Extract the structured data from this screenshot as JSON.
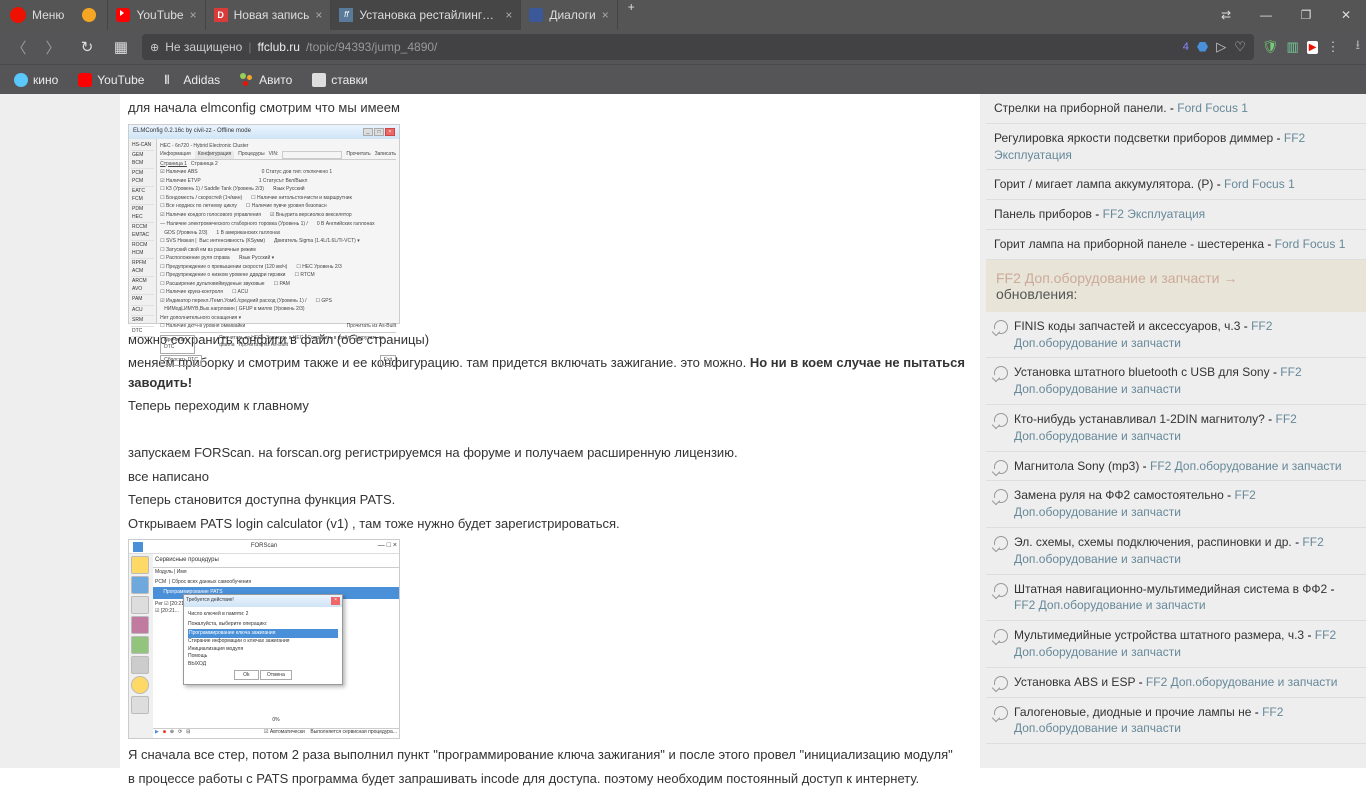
{
  "titlebar": {
    "menu": "Меню",
    "tabs": [
      {
        "title": "",
        "fav_color": "#f5a623"
      },
      {
        "title": "YouTube",
        "fav_color": "#ff0000"
      },
      {
        "title": "Новая запись",
        "fav_color": "#d93a3a",
        "fav_letter": "D"
      },
      {
        "title": "Установка рестайлингово",
        "fav_color": "#5a7a99",
        "fav_letter": "ff",
        "active": true
      },
      {
        "title": "Диалоги",
        "fav_color": "#3b5998"
      }
    ]
  },
  "address": {
    "insecure": "Не защищено",
    "domain": "ffclub.ru",
    "path": "/topic/94393/jump_4890/",
    "badge": "4"
  },
  "bookmarks": [
    {
      "label": "кино",
      "color": "#5ac8fa"
    },
    {
      "label": "YouTube",
      "color": "#ff0000"
    },
    {
      "label": "Adidas",
      "color": "#fff"
    },
    {
      "label": "Авито",
      "color": "#97d058"
    },
    {
      "label": "ставки",
      "color": "#ddd"
    }
  ],
  "post": {
    "p1": "для начала elmconfig смотрим что мы имеем",
    "p2": "можно сохранить конфиги в файл (обе страницы)",
    "p3": "меняем приборку и смотрим также и ее конфигурацию. там придется включать зажигание. это можно. ",
    "p3b": "Но ни в коем случае не пытаться заводить!",
    "p4": "Теперь переходим к главному",
    "p5": "запускаем FORScan. на forscan.org регистрируемся на форуме и получаем расширенную лицензию.",
    "p6": "все написано",
    "p7": "Теперь становится доступна функция PATS.",
    "p8": "Открываем PATS login calculator (v1) , там тоже нужно будет зарегистрироваться.",
    "p9": "Я сначала все стер, потом 2 раза выполнил пункт \"программирование ключа зажигания\" и после этого провел \"инициализацию модуля\"",
    "p10": "в процессе работы с PATS программа будет запрашивать incode для доступа. поэтому необходим постоянный доступ к интернету.",
    "elm_title": "ELMConfig 0.2.16c by civil-zz - Offline mode",
    "for_title": "FORScan",
    "for_proc": "Сервисные процедуры",
    "for_dlg_title": "Требуется действие!",
    "for_dlg_keys": "Число ключей в памяти: 2",
    "for_dlg_prompt": "Пожалуйста, выберите операцию:",
    "for_dlg_sel": "Программирование ключа зажигания",
    "for_dlg_o1": "Стирание информации о ключах зажигания",
    "for_dlg_o2": "Инициализация модуля",
    "for_dlg_o3": "Помощь",
    "for_dlg_o4": "ВЫХОД",
    "for_ok": "Ok",
    "for_cancel": "Отмена"
  },
  "sidebar1": [
    {
      "t": "Стрелки на приборной панели.",
      "c": "Ford Focus 1"
    },
    {
      "t": "Регулировка яркости подсветки приборов диммер",
      "c": "FF2 Эксплуатация"
    },
    {
      "t": "Горит / мигает лампа аккумулятора. (P)",
      "c": "Ford Focus 1"
    },
    {
      "t": "Панель приборов",
      "c": "FF2 Эксплуатация"
    },
    {
      "t": "Горит лампа на приборной панеле - шестеренка",
      "c": "Ford Focus 1"
    }
  ],
  "sidebar_head": {
    "title": "FF2 Доп.оборудование и запчасти",
    "sub": "обновления:"
  },
  "sidebar2": [
    {
      "t": "FINIS коды запчастей и аксессуаров, ч.3",
      "c": "FF2 Доп.оборудование и запчасти"
    },
    {
      "t": "Установка штатного bluetooth с USB для Sony",
      "c": "FF2 Доп.оборудование и запчасти"
    },
    {
      "t": "Кто-нибудь устанавливал 1-2DIN магнитолу?",
      "c": "FF2 Доп.оборудование и запчасти"
    },
    {
      "t": "Магнитола Sony (mp3)",
      "c": "FF2 Доп.оборудование и запчасти"
    },
    {
      "t": "Замена руля на ФФ2 самостоятельно",
      "c": "FF2 Доп.оборудование и запчасти"
    },
    {
      "t": "Эл. схемы, схемы подключения, распиновки и др.",
      "c": "FF2 Доп.оборудование и запчасти"
    },
    {
      "t": "Штатная навигационно-мультимедийная система в ФФ2",
      "c": "FF2 Доп.оборудование и запчасти"
    },
    {
      "t": "Мультимедийные устройства штатного размера, ч.3",
      "c": "FF2 Доп.оборудование и запчасти"
    },
    {
      "t": "Установка ABS и ESP",
      "c": "FF2 Доп.оборудование и запчасти"
    },
    {
      "t": "Галогеновые, диодные и прочие лампы не",
      "c": "FF2 Доп.оборудование и запчасти"
    }
  ]
}
